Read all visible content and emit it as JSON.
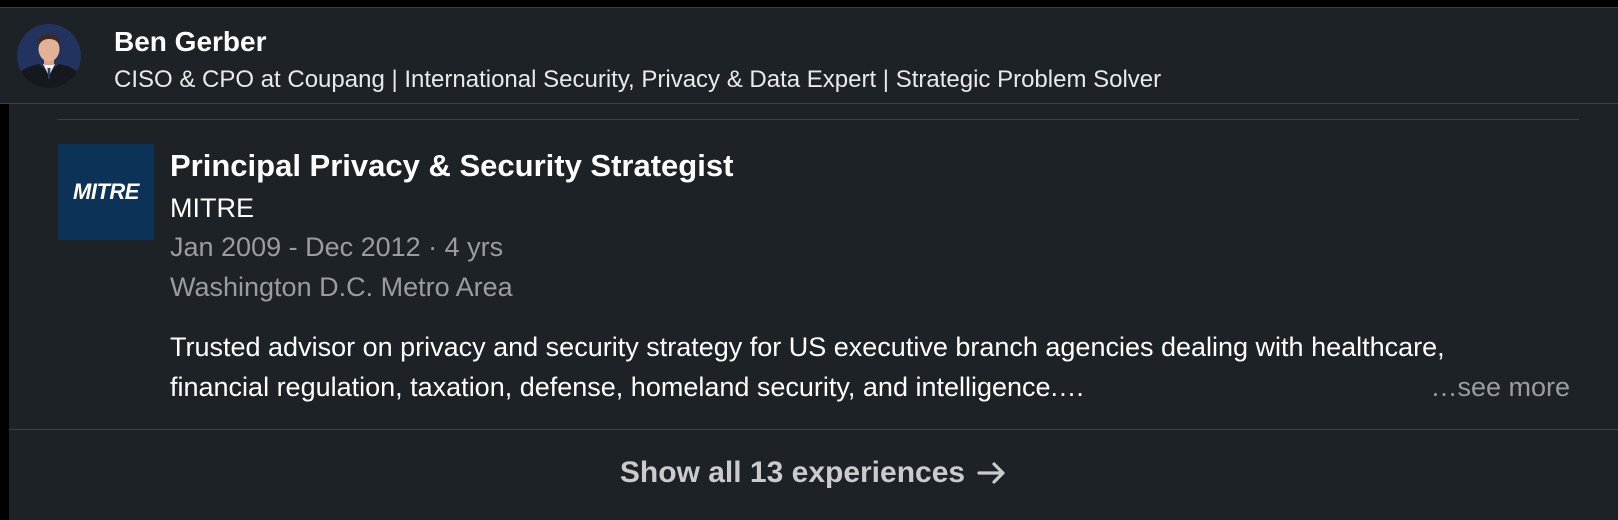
{
  "profile_header": {
    "name": "Ben Gerber",
    "headline": "CISO & CPO at Coupang | International Security, Privacy & Data Expert | Strategic Problem Solver",
    "avatar_icon": "person-photo"
  },
  "experience": {
    "logo_text": "MITRE",
    "title": "Principal Privacy & Security Strategist",
    "company": "MITRE",
    "dates": "Jan 2009 - Dec 2012 · 4 yrs",
    "location": "Washington D.C. Metro Area",
    "description_line1": "Trusted advisor on privacy and security strategy for US executive branch agencies dealing with healthcare,",
    "description_line2": "financial regulation, taxation, defense, homeland security, and intelligence.…",
    "see_more_label": "…see more"
  },
  "footer": {
    "show_all_label": "Show all 13 experiences",
    "arrow_icon": "arrow-right-icon"
  },
  "colors": {
    "background": "#1d2226",
    "text_primary": "#ffffff",
    "text_secondary": "#9a9d9f",
    "logo_bg": "#0d3258",
    "divider": "#3a3f44"
  }
}
